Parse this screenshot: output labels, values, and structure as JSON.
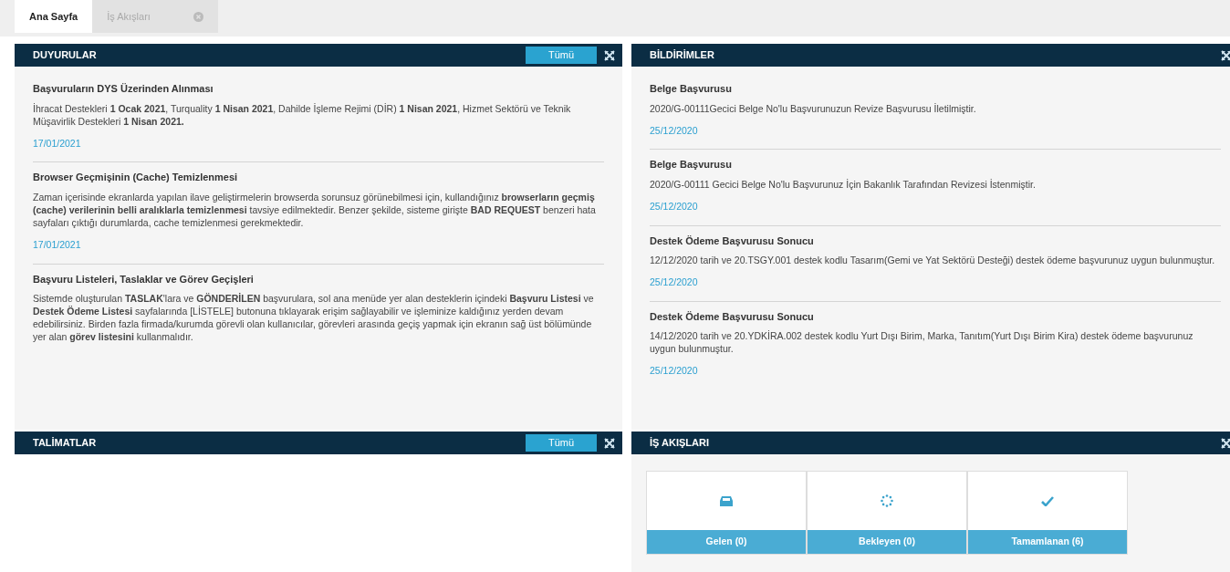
{
  "tabs": [
    {
      "label": "Ana Sayfa",
      "selected": true,
      "closable": false
    },
    {
      "label": "İş Akışları",
      "selected": false,
      "closable": true
    }
  ],
  "announcements": {
    "title": "DUYURULAR",
    "all_button": "Tümü",
    "items": [
      {
        "title": "Başvuruların DYS Üzerinden Alınması",
        "body": "İhracat Destekleri **1 Ocak 2021**, Turquality **1 Nisan 2021**, Dahilde İşleme Rejimi (DİR) **1 Nisan 2021**, Hizmet Sektörü ve Teknik Müşavirlik Destekleri **1 Nisan 2021.**",
        "date": "17/01/2021"
      },
      {
        "title": "Browser Geçmişinin (Cache) Temizlenmesi",
        "body": "Zaman içerisinde ekranlarda yapılan ilave geliştirmelerin browserda sorunsuz görünebilmesi için, kullandığınız **browserların geçmiş (cache) verilerinin belli aralıklarla temizlenmesi** tavsiye edilmektedir. Benzer şekilde, sisteme girişte **BAD REQUEST** benzeri hata sayfaları çıktığı durumlarda, cache temizlenmesi gerekmektedir.",
        "date": "17/01/2021"
      },
      {
        "title": "Başvuru Listeleri, Taslaklar ve Görev Geçişleri",
        "body": "Sistemde oluşturulan **TASLAK**'lara ve **GÖNDERİLEN** başvurulara, sol ana menüde yer alan desteklerin içindeki **Başvuru Listesi** ve **Destek Ödeme Listesi** sayfalarında [LİSTELE] butonuna tıklayarak erişim sağlayabilir ve işleminize kaldığınız yerden devam edebilirsiniz. Birden fazla firmada/kurumda görevli olan kullanıcılar, görevleri arasında geçiş yapmak için ekranın sağ üst bölümünde yer alan **görev listesini** kullanmalıdır."
      }
    ]
  },
  "notifications": {
    "title": "BİLDİRİMLER",
    "items": [
      {
        "title": "Belge Başvurusu",
        "body": "2020/G-00111Gecici Belge No'lu Başvurunuzun Revize Başvurusu İletilmiştir.",
        "date": "25/12/2020"
      },
      {
        "title": "Belge Başvurusu",
        "body": "2020/G-00111 Gecici Belge No'lu Başvurunuz İçin Bakanlık Tarafından Revizesi İstenmiştir.",
        "date": "25/12/2020"
      },
      {
        "title": "Destek Ödeme Başvurusu Sonucu",
        "body": "12/12/2020 tarih ve 20.TSGY.001 destek kodlu Tasarım(Gemi ve Yat Sektörü Desteği) destek ödeme başvurunuz uygun bulunmuştur.",
        "date": "25/12/2020"
      },
      {
        "title": "Destek Ödeme Başvurusu Sonucu",
        "body": "14/12/2020 tarih ve 20.YDKİRA.002 destek kodlu Yurt Dışı Birim, Marka, Tanıtım(Yurt Dışı Birim Kira) destek ödeme başvurunuz uygun bulunmuştur.",
        "date": "25/12/2020"
      }
    ]
  },
  "instructions": {
    "title": "TALİMATLAR",
    "all_button": "Tümü"
  },
  "workflows": {
    "title": "İŞ AKIŞLARI",
    "tiles": [
      {
        "kind": "inbox",
        "label": "Gelen (0)"
      },
      {
        "kind": "pending",
        "label": "Bekleyen (0)"
      },
      {
        "kind": "done",
        "label": "Tamamlanan (6)"
      }
    ]
  }
}
